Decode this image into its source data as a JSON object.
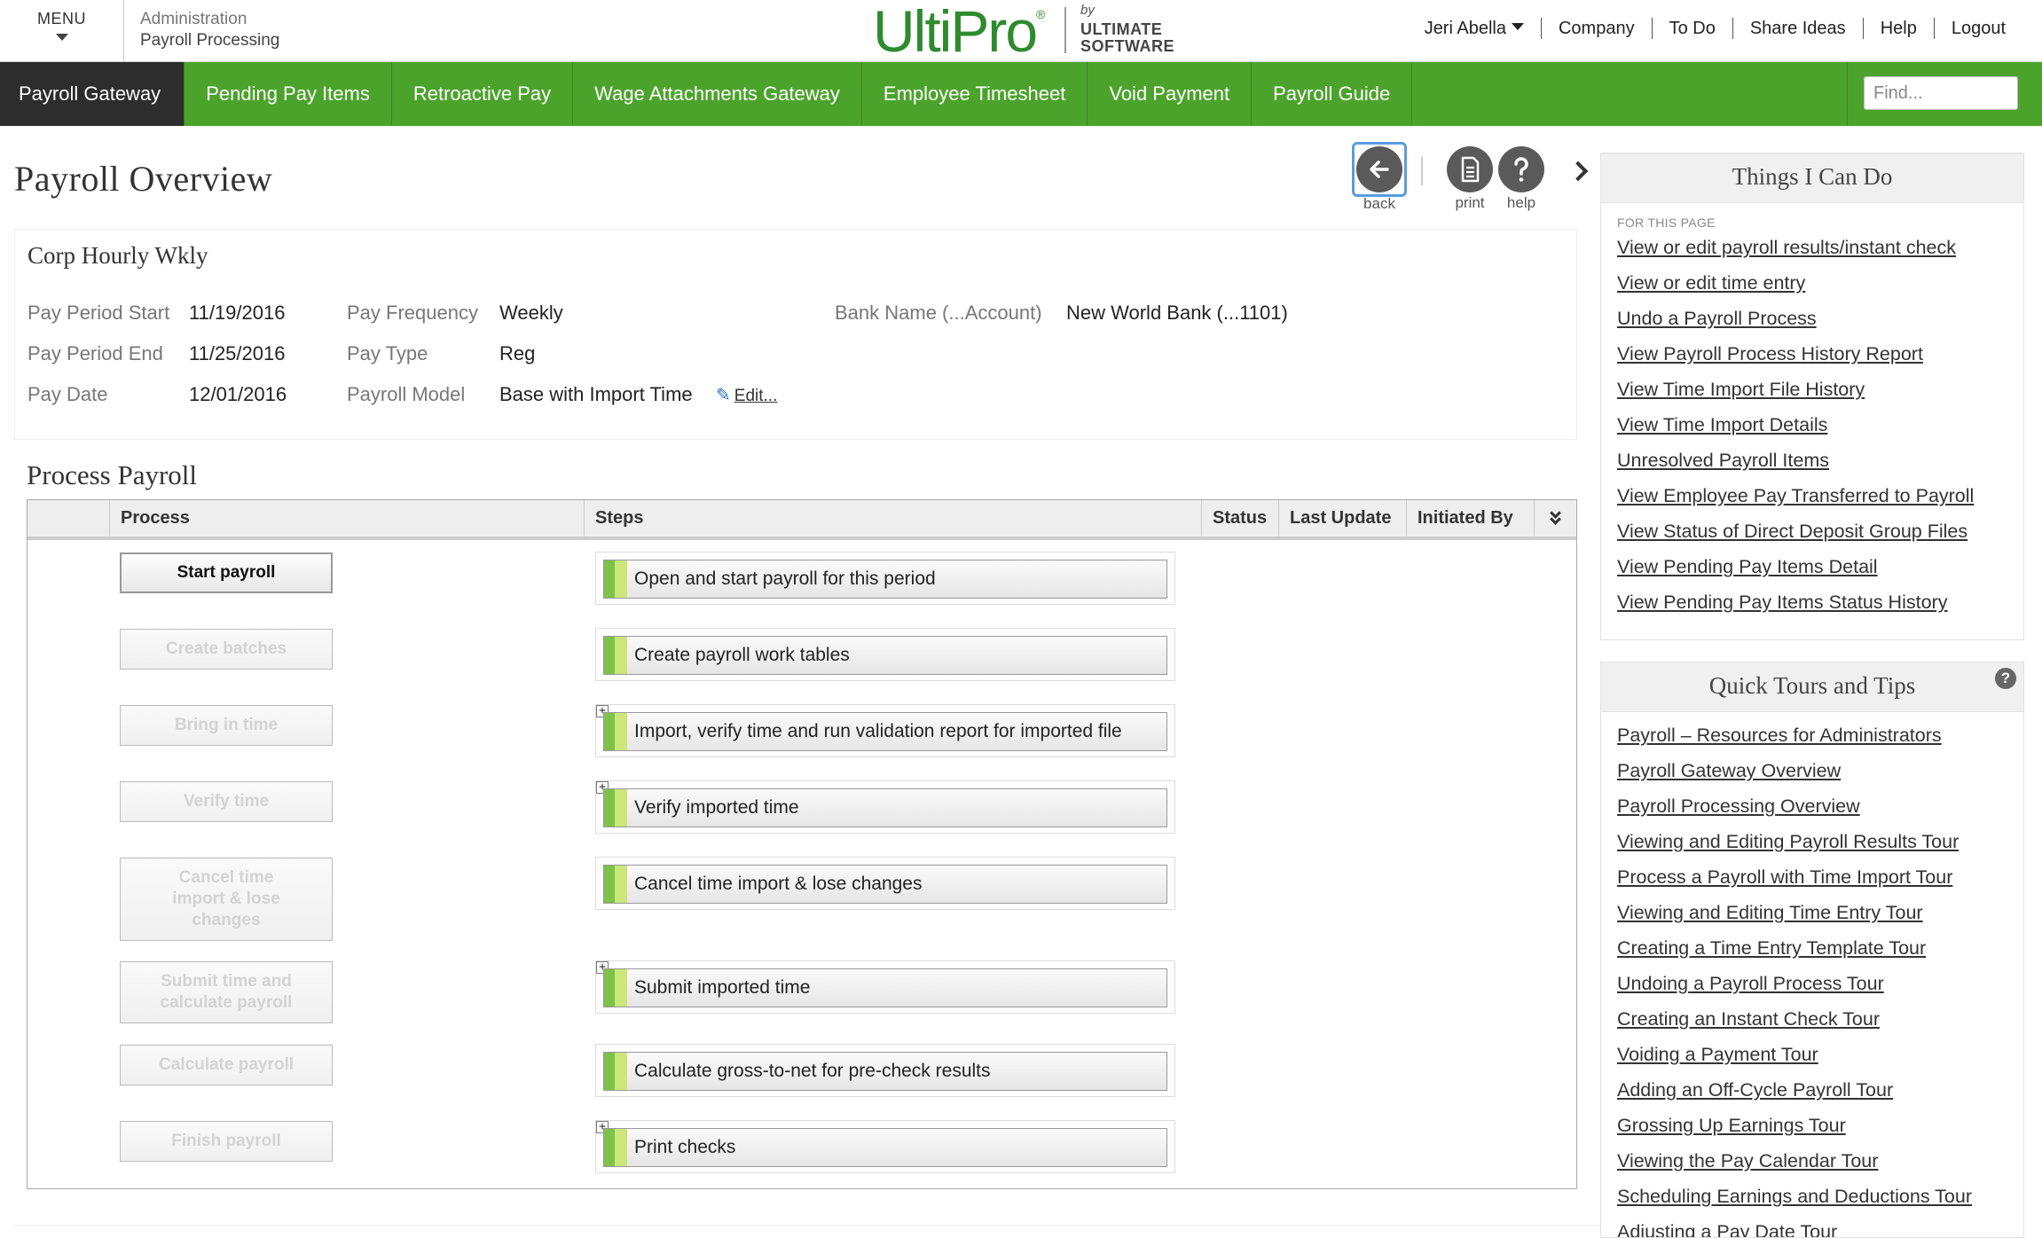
{
  "topbar": {
    "menu_label": "MENU",
    "breadcrumb_parent": "Administration",
    "breadcrumb_current": "Payroll Processing",
    "logo_main": "UltiPro",
    "logo_by": "by",
    "logo_company_line1": "ULTIMATE",
    "logo_company_line2": "SOFTWARE",
    "user_name": "Jeri Abella",
    "links": [
      "Company",
      "To Do",
      "Share Ideas",
      "Help",
      "Logout"
    ]
  },
  "nav": {
    "tabs": [
      "Payroll Gateway",
      "Pending Pay Items",
      "Retroactive Pay",
      "Wage Attachments Gateway",
      "Employee Timesheet",
      "Void Payment",
      "Payroll Guide"
    ],
    "active_tab": "Payroll Gateway",
    "search_placeholder": "Find..."
  },
  "page": {
    "title": "Payroll Overview",
    "tools": {
      "back": "back",
      "print": "print",
      "help": "help"
    }
  },
  "summary": {
    "company": "Corp Hourly Wkly",
    "fields": {
      "pay_period_start": {
        "label": "Pay Period Start",
        "value": "11/19/2016"
      },
      "pay_period_end": {
        "label": "Pay Period End",
        "value": "11/25/2016"
      },
      "pay_date": {
        "label": "Pay Date",
        "value": "12/01/2016"
      },
      "pay_frequency": {
        "label": "Pay Frequency",
        "value": "Weekly"
      },
      "pay_type": {
        "label": "Pay Type",
        "value": "Reg"
      },
      "payroll_model": {
        "label": "Payroll Model",
        "value": "Base with Import Time"
      },
      "bank_name": {
        "label": "Bank Name (...Account)",
        "value": "New World Bank (...1101)"
      }
    },
    "edit_label": "Edit..."
  },
  "process": {
    "title": "Process Payroll",
    "columns": [
      "Process",
      "Steps",
      "Status",
      "Last Update",
      "Initiated By"
    ],
    "rows": [
      {
        "button": "Start payroll",
        "step": "Open and start payroll for this period"
      },
      {
        "button": "Create batches",
        "step": "Create payroll work tables"
      },
      {
        "button": "Bring in time",
        "step": "Import, verify time and run validation report for imported file"
      },
      {
        "button": "Verify time",
        "step": "Verify imported time"
      },
      {
        "button": "Cancel time import & lose changes",
        "step": "Cancel time import & lose changes"
      },
      {
        "button": "Submit time and calculate payroll",
        "step": "Submit imported time"
      },
      {
        "button": "Calculate payroll",
        "step": "Calculate gross-to-net for pre-check results"
      },
      {
        "button": "Finish payroll",
        "step": "Print checks"
      }
    ]
  },
  "things_i_can_do": {
    "title": "Things I Can Do",
    "caption": "FOR THIS PAGE",
    "links": [
      "View or edit payroll results/instant check",
      "View or edit time entry",
      "Undo a Payroll Process",
      "View Payroll Process History Report",
      "View Time Import File History",
      "View Time Import Details",
      "Unresolved Payroll Items",
      "View Employee Pay Transferred to Payroll",
      "View Status of Direct Deposit Group Files",
      "View Pending Pay Items Detail",
      "View Pending Pay Items Status History"
    ]
  },
  "quick_tours": {
    "title": "Quick Tours and Tips",
    "help_glyph": "?",
    "links": [
      "Payroll – Resources for Administrators",
      "Payroll Gateway Overview",
      "Payroll Processing Overview",
      "Viewing and Editing Payroll Results Tour",
      "Process a Payroll with Time Import Tour",
      "Viewing and Editing Time Entry Tour",
      "Creating a Time Entry Template Tour",
      "Undoing a Payroll Process Tour",
      "Creating an Instant Check Tour",
      "Voiding a Payment Tour",
      "Adding an Off-Cycle Payroll Tour",
      "Grossing Up Earnings Tour",
      "Viewing the Pay Calendar Tour",
      "Scheduling Earnings and Deductions Tour",
      "Adjusting a Pay Date Tour"
    ]
  },
  "icons": {
    "menu": "chevron-down-icon",
    "back": "arrow-left-icon",
    "print": "document-icon",
    "help": "question-icon",
    "next": "chevron-right-icon",
    "edit": "pencil-icon",
    "collapse": "double-chevron-down-icon",
    "expand": "plus-box-icon"
  },
  "colors": {
    "brand_green": "#4ca32c",
    "logo_green": "#2e8b2e",
    "active_tab": "#2d2d2d",
    "step_accent": "#7ec24a",
    "step_accent_light": "#cbe67a",
    "focus_ring": "#5b9be0"
  }
}
